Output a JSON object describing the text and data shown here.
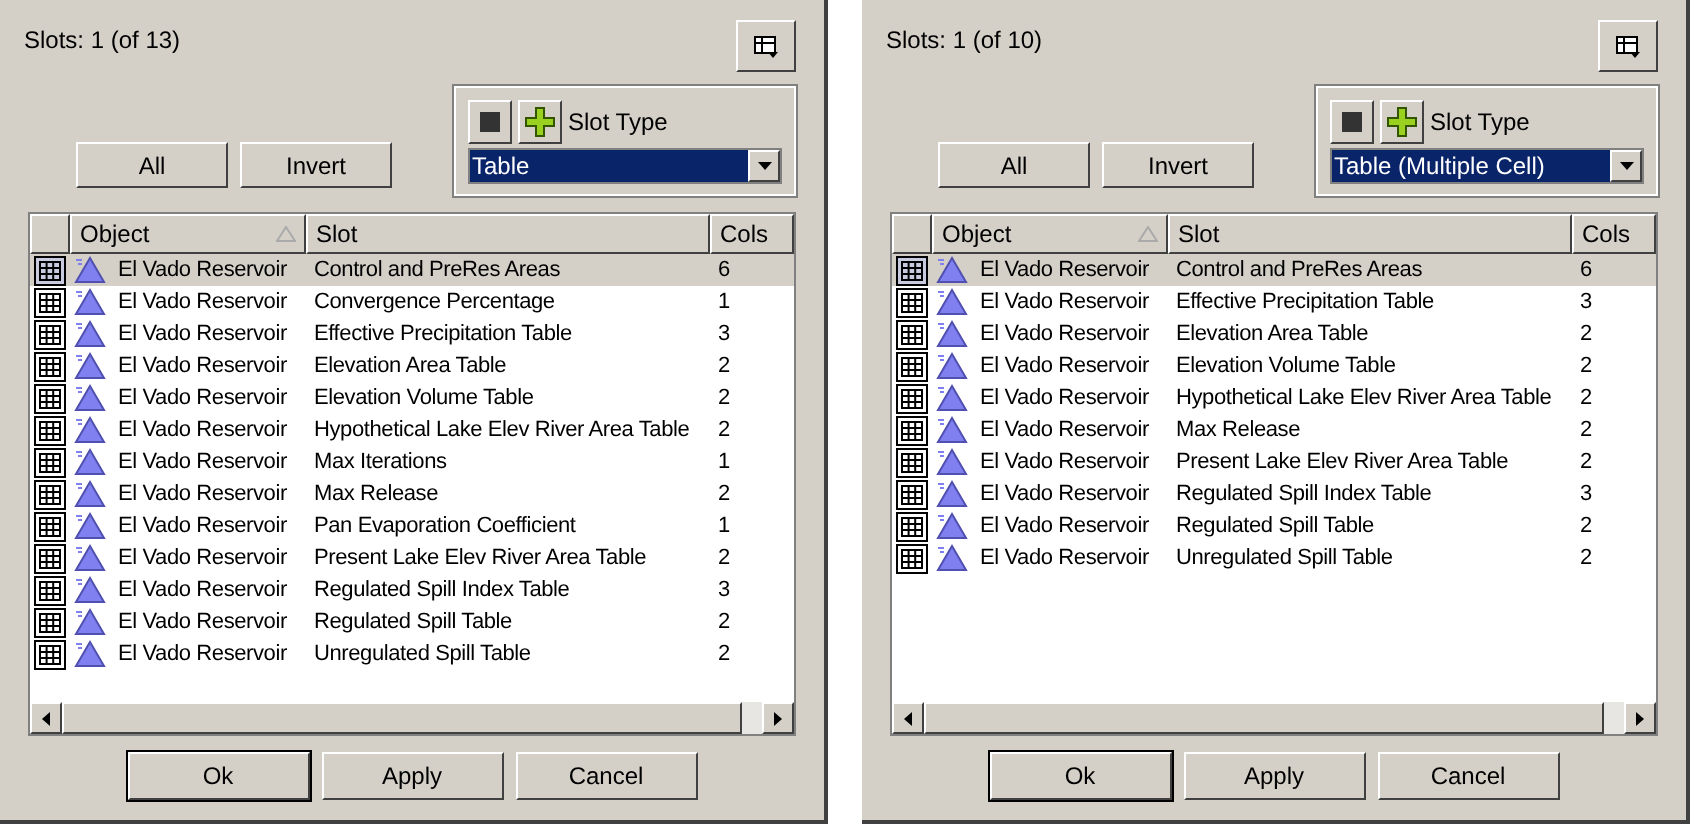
{
  "panels": [
    {
      "slots_label": "Slots: 1 (of 13)",
      "slot_type_label": "Slot Type",
      "slot_type_value": "Table",
      "select_buttons": [
        "All",
        "Invert"
      ],
      "columns": [
        "Object",
        "Slot",
        "Cols"
      ],
      "rows": [
        {
          "object": "El Vado Reservoir",
          "slot": "Control and PreRes Areas",
          "cols": "6",
          "selected": true
        },
        {
          "object": "El Vado Reservoir",
          "slot": "Convergence Percentage",
          "cols": "1",
          "selected": false
        },
        {
          "object": "El Vado Reservoir",
          "slot": "Effective Precipitation Table",
          "cols": "3",
          "selected": false
        },
        {
          "object": "El Vado Reservoir",
          "slot": "Elevation Area Table",
          "cols": "2",
          "selected": false
        },
        {
          "object": "El Vado Reservoir",
          "slot": "Elevation Volume Table",
          "cols": "2",
          "selected": false
        },
        {
          "object": "El Vado Reservoir",
          "slot": "Hypothetical Lake Elev River Area Table",
          "cols": "2",
          "selected": false
        },
        {
          "object": "El Vado Reservoir",
          "slot": "Max Iterations",
          "cols": "1",
          "selected": false
        },
        {
          "object": "El Vado Reservoir",
          "slot": "Max Release",
          "cols": "2",
          "selected": false
        },
        {
          "object": "El Vado Reservoir",
          "slot": "Pan Evaporation Coefficient",
          "cols": "1",
          "selected": false
        },
        {
          "object": "El Vado Reservoir",
          "slot": "Present Lake Elev River Area Table",
          "cols": "2",
          "selected": false
        },
        {
          "object": "El Vado Reservoir",
          "slot": "Regulated Spill Index Table",
          "cols": "3",
          "selected": false
        },
        {
          "object": "El Vado Reservoir",
          "slot": "Regulated Spill Table",
          "cols": "2",
          "selected": false
        },
        {
          "object": "El Vado Reservoir",
          "slot": "Unregulated Spill Table",
          "cols": "2",
          "selected": false
        }
      ],
      "buttons": [
        "Ok",
        "Apply",
        "Cancel"
      ]
    },
    {
      "slots_label": "Slots: 1 (of 10)",
      "slot_type_label": "Slot Type",
      "slot_type_value": "Table (Multiple Cell)",
      "select_buttons": [
        "All",
        "Invert"
      ],
      "columns": [
        "Object",
        "Slot",
        "Cols"
      ],
      "rows": [
        {
          "object": "El Vado Reservoir",
          "slot": "Control and PreRes Areas",
          "cols": "6",
          "selected": true
        },
        {
          "object": "El Vado Reservoir",
          "slot": "Effective Precipitation Table",
          "cols": "3",
          "selected": false
        },
        {
          "object": "El Vado Reservoir",
          "slot": "Elevation Area Table",
          "cols": "2",
          "selected": false
        },
        {
          "object": "El Vado Reservoir",
          "slot": "Elevation Volume Table",
          "cols": "2",
          "selected": false
        },
        {
          "object": "El Vado Reservoir",
          "slot": "Hypothetical Lake Elev River Area Table",
          "cols": "2",
          "selected": false
        },
        {
          "object": "El Vado Reservoir",
          "slot": "Max Release",
          "cols": "2",
          "selected": false
        },
        {
          "object": "El Vado Reservoir",
          "slot": "Present Lake Elev River Area Table",
          "cols": "2",
          "selected": false
        },
        {
          "object": "El Vado Reservoir",
          "slot": "Regulated Spill Index Table",
          "cols": "3",
          "selected": false
        },
        {
          "object": "El Vado Reservoir",
          "slot": "Regulated Spill Table",
          "cols": "2",
          "selected": false
        },
        {
          "object": "El Vado Reservoir",
          "slot": "Unregulated Spill Table",
          "cols": "2",
          "selected": false
        }
      ],
      "buttons": [
        "Ok",
        "Apply",
        "Cancel"
      ]
    }
  ]
}
